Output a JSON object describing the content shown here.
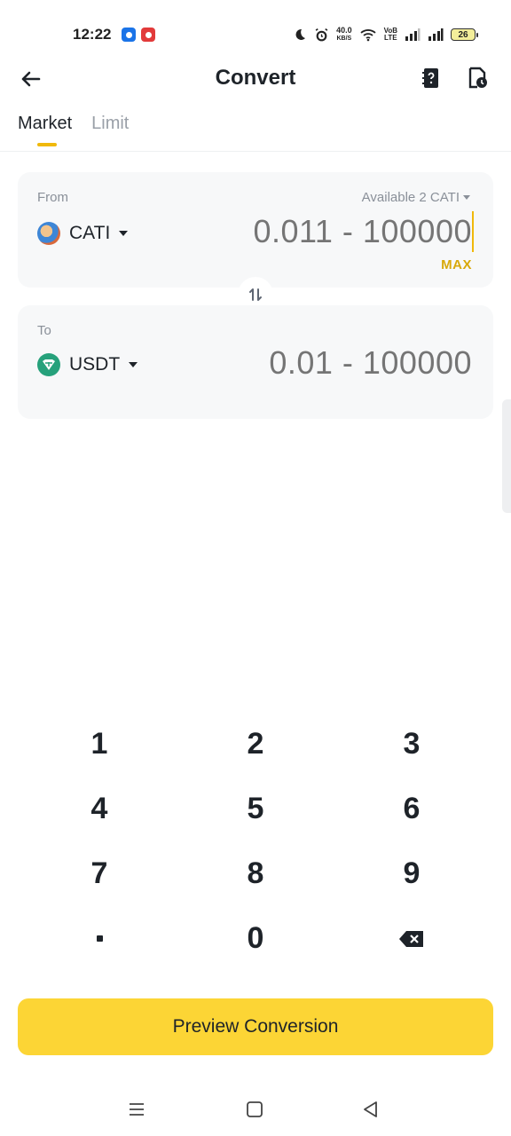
{
  "status_bar": {
    "time": "12:22",
    "net_speed": "40.0",
    "net_unit": "KB/S",
    "volte_top": "VoB",
    "volte_bottom": "LTE",
    "battery": "26"
  },
  "header": {
    "title": "Convert",
    "icons": [
      "back-arrow-icon",
      "order-book-icon",
      "history-icon"
    ]
  },
  "tabs": [
    {
      "label": "Market",
      "active": true
    },
    {
      "label": "Limit",
      "active": false
    }
  ],
  "from": {
    "label": "From",
    "available": "Available 2 CATI",
    "asset": "CATI",
    "placeholder": "0.011 - 100000",
    "max_label": "MAX"
  },
  "to": {
    "label": "To",
    "asset": "USDT",
    "placeholder": "0.01 - 100000"
  },
  "keypad": [
    "1",
    "2",
    "3",
    "4",
    "5",
    "6",
    "7",
    "8",
    "9",
    ".",
    "0",
    "backspace"
  ],
  "keypad_labels": {
    "k1": "1",
    "k2": "2",
    "k3": "3",
    "k4": "4",
    "k5": "5",
    "k6": "6",
    "k7": "7",
    "k8": "8",
    "k9": "9",
    "k0": "0"
  },
  "preview_button": "Preview Conversion",
  "colors": {
    "accent": "#fcd535",
    "accent_text": "#d8a90b",
    "usdt": "#26a17b"
  }
}
